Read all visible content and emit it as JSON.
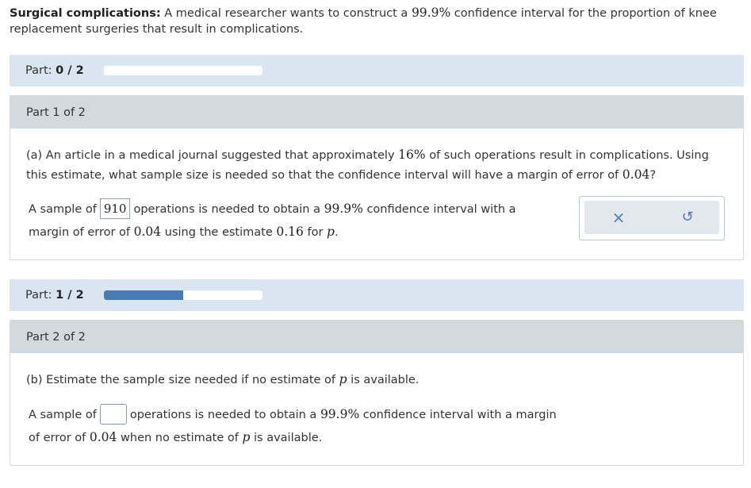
{
  "header": {
    "title": "Surgical complications:",
    "text_before": "A medical researcher wants to construct a",
    "confidence": "99.9%",
    "text_after": "confidence interval for the proportion of knee replacement surgeries that result in complications."
  },
  "part_progress_1": {
    "label": "Part:",
    "value": "0 / 2",
    "fraction": 0.0
  },
  "part1": {
    "heading": "Part 1 of 2",
    "q_a": "(a) An article in a medical journal suggested that approximately",
    "q_pct": "16%",
    "q_b": "of such operations result in complications. Using this estimate, what sample size is needed so that the confidence interval will have a margin of error of",
    "q_moe": "0.04",
    "q_end": "?",
    "ans_prefix": "A sample of",
    "ans_value": "910",
    "ans_mid": "operations is needed to obtain a",
    "ans_conf": "99.9%",
    "ans_mid2": "confidence interval with a margin of error of",
    "ans_moe": "0.04",
    "ans_mid3": "using the estimate",
    "ans_est": "0.16",
    "ans_for": "for",
    "ans_var": "p",
    "ans_end": "."
  },
  "actions": {
    "clear_icon": "close-icon",
    "undo_icon": "undo-icon",
    "clear_glyph": "×",
    "undo_glyph": "↺"
  },
  "part_progress_2": {
    "label": "Part:",
    "value": "1 / 2",
    "fraction": 0.5
  },
  "part2": {
    "heading": "Part 2 of 2",
    "q_a": "(b) Estimate the sample size needed if no estimate of",
    "q_var": "p",
    "q_b": "is available.",
    "ans_prefix": "A sample of",
    "ans_value": "",
    "ans_mid": "operations is needed to obtain a",
    "ans_conf": "99.9%",
    "ans_mid2": "confidence interval with a margin of error of",
    "ans_moe": "0.04",
    "ans_mid3": "when no estimate of",
    "ans_var": "p",
    "ans_end": "is available."
  },
  "colors": {
    "accent": "#4a7bb7",
    "part_bar_bg": "#d9e5f0",
    "card_head_bg": "#d2dadf"
  }
}
